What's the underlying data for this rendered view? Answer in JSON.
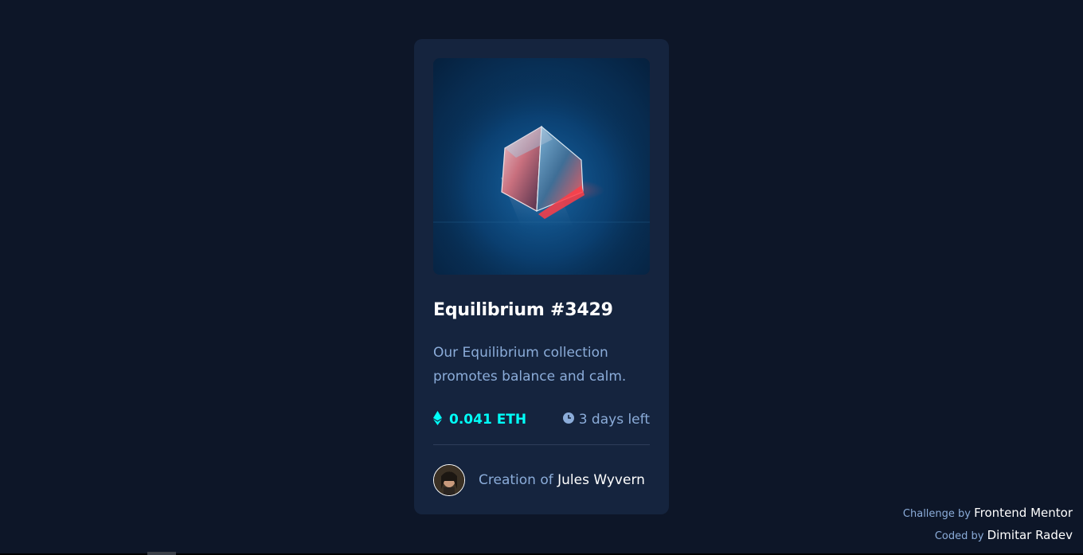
{
  "card": {
    "image_alt": "Equilibrium",
    "title": "Equilibrium #3429",
    "description": "Our Equilibrium collection promotes balance and calm.",
    "price": "0.041 ETH",
    "time_left": "3 days left",
    "creator_prefix": "Creation of",
    "creator_name": "Jules Wyvern",
    "icons": {
      "price": "ethereum-icon",
      "time": "clock-icon"
    }
  },
  "attribution": {
    "challenge_prefix": "Challenge by",
    "challenge_name": "Frontend Mentor",
    "coded_prefix": "Coded by",
    "coded_name": "Dimitar Radev"
  },
  "colors": {
    "background": "#0d1628",
    "card": "#15243e",
    "accent": "#00fff8",
    "muted_text": "#8bacd9",
    "white": "#ffffff"
  }
}
